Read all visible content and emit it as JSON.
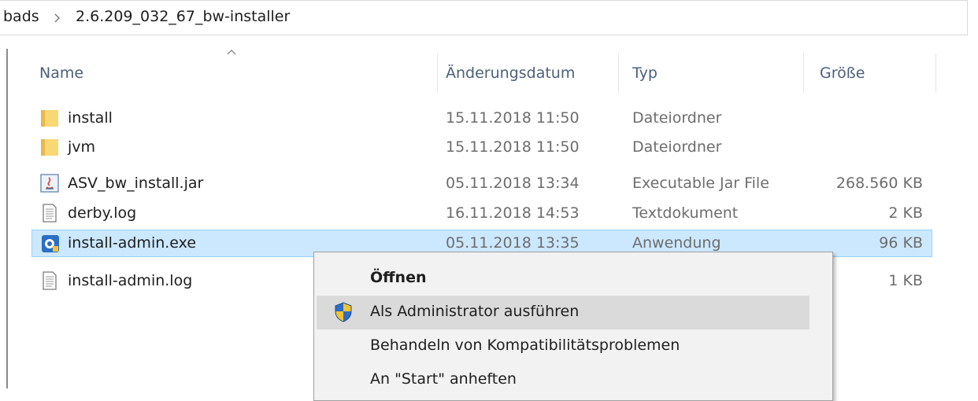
{
  "address_bar": {
    "previous_crumb": "bads",
    "separator": "›",
    "current_folder": "2.6.209_032_67_bw-installer"
  },
  "columns": {
    "name": "Name",
    "date": "Änderungsdatum",
    "type": "Typ",
    "size": "Größe",
    "sort_indicator": "chevron-up-icon"
  },
  "files": [
    {
      "name": "install",
      "date": "15.11.2018 11:50",
      "type": "Dateiordner",
      "size": "",
      "icon": "folder-icon"
    },
    {
      "name": "jvm",
      "date": "15.11.2018 11:50",
      "type": "Dateiordner",
      "size": "",
      "icon": "folder-icon"
    },
    {
      "name": "ASV_bw_install.jar",
      "date": "05.11.2018 13:34",
      "type": "Executable Jar File",
      "size": "268.560 KB",
      "icon": "java-jar-icon"
    },
    {
      "name": "derby.log",
      "date": "16.11.2018 14:53",
      "type": "Textdokument",
      "size": "2 KB",
      "icon": "text-file-icon"
    },
    {
      "name": "install-admin.exe",
      "date": "05.11.2018 13:35",
      "type": "Anwendung",
      "size": "96 KB",
      "icon": "exe-application-icon",
      "selected": true
    },
    {
      "name": "install-admin.log",
      "date": "",
      "type": "",
      "size": "1 KB",
      "icon": "text-file-icon"
    }
  ],
  "context_menu": {
    "items": [
      {
        "label": "Öffnen",
        "bold": true
      },
      {
        "label": "Als Administrator ausführen",
        "icon": "uac-shield-icon",
        "hover": true
      },
      {
        "label": "Behandeln von Kompatibilitätsproblemen"
      },
      {
        "label": "An \"Start\" anheften"
      }
    ]
  },
  "colors": {
    "selection_bg": "#cce8ff",
    "selection_border": "#99d1ff",
    "header_text": "#4c607a",
    "menu_bg": "#f2f2f2",
    "menu_hover": "#dadada",
    "folder": "#f8d775"
  }
}
